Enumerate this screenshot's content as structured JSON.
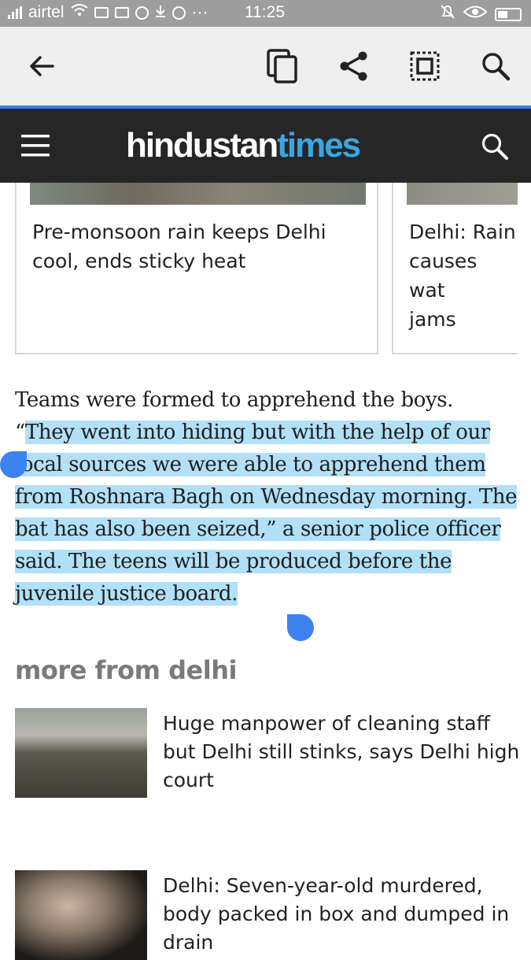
{
  "status_bar": {
    "carrier": "airtel",
    "time": "11:25",
    "dots": "···"
  },
  "browser_toolbar": {
    "back_icon": "arrow-left-icon",
    "copy_icon": "copy-icon",
    "share_icon": "share-icon",
    "select_all_icon": "select-all-icon",
    "search_icon": "search-icon"
  },
  "site_header": {
    "logo_part1": "hindustan",
    "logo_part2": "times",
    "logo_accent": "#3aa6e0",
    "menu_icon": "hamburger-menu-icon",
    "search_icon": "search-icon"
  },
  "related_cards": [
    {
      "title": "Pre-monsoon rain keeps Delhi\ncool, ends sticky heat"
    },
    {
      "title": "Delhi: Rain\ncauses wat\njams"
    }
  ],
  "article": {
    "text_plain": "Teams were formed to apprehend the boys. “",
    "text_selected": "They went into hiding but with the help of our local sources we were able to apprehend them from Roshnara Bagh on Wednesday morning. The bat has also been seized,” a senior police officer said. The teens will be produced before the juvenile justice board.",
    "selection_color": "#b2e0f7"
  },
  "more_section": {
    "title": "more from delhi",
    "stories": [
      {
        "title": "Huge manpower of cleaning staff but Delhi still stinks, says Delhi high court"
      },
      {
        "title": "Delhi: Seven-year-old murdered, body packed in box and dumped in drain"
      }
    ]
  }
}
